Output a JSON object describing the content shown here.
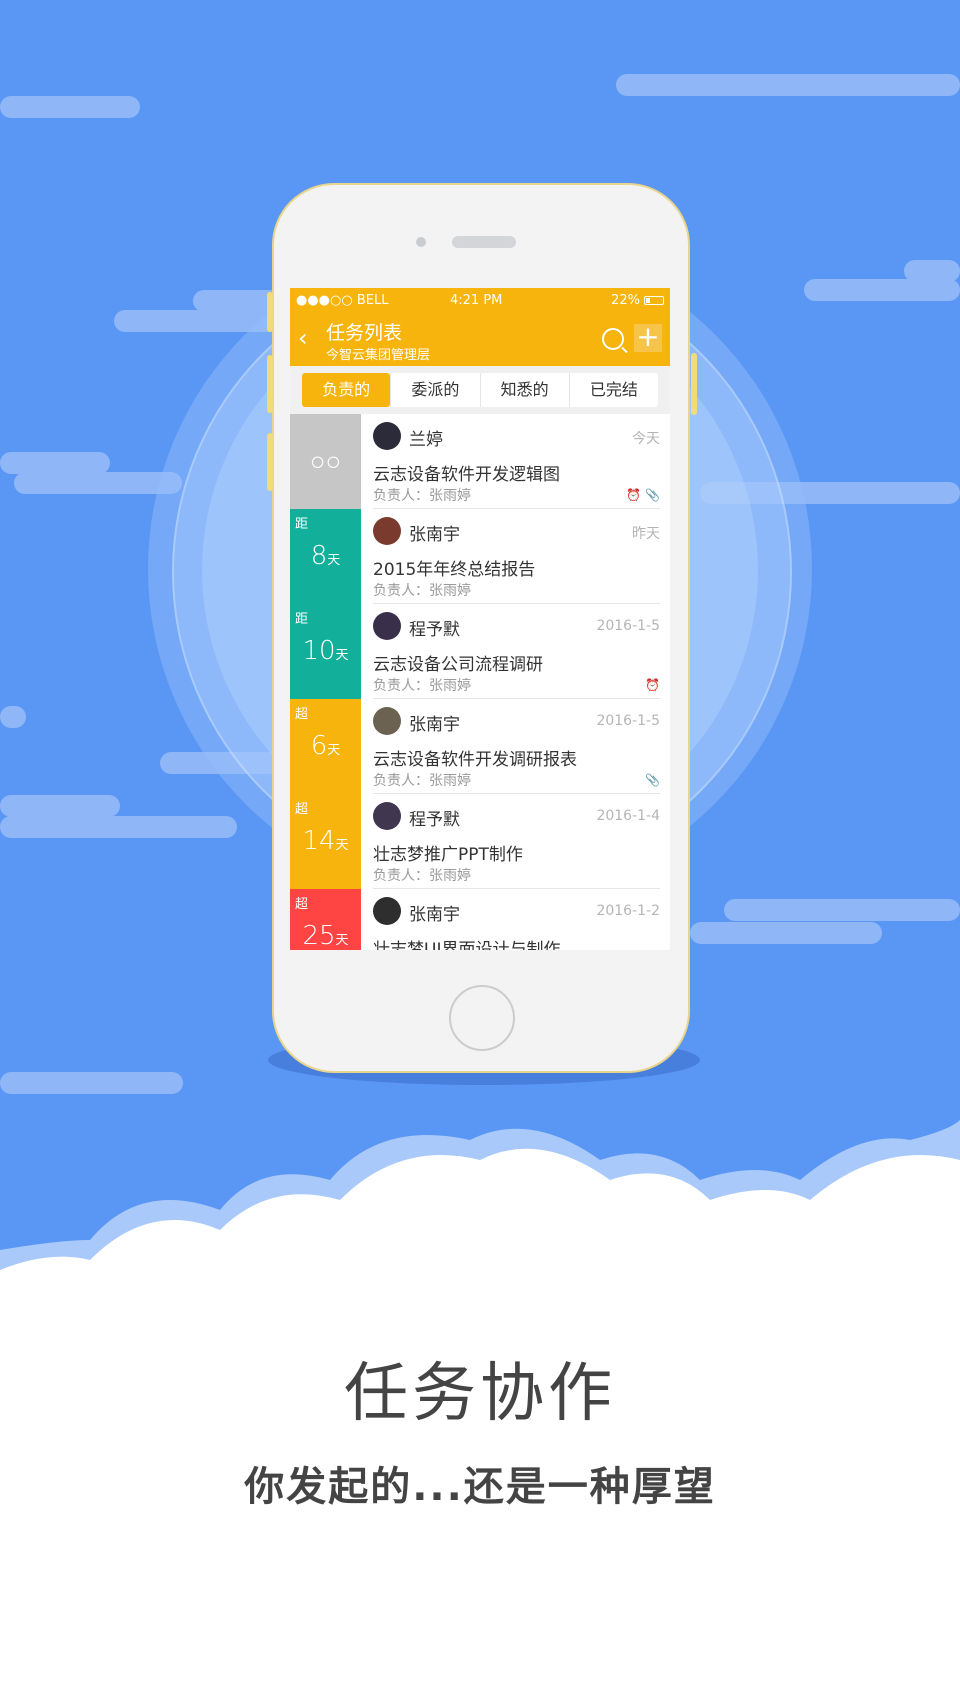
{
  "status_bar": {
    "carrier": "●●●○○ BELL",
    "time": "4:21 PM",
    "battery": "22%"
  },
  "nav": {
    "title": "任务列表",
    "subtitle": "今智云集团管理层"
  },
  "tabs": [
    {
      "label": "负责的",
      "active": true
    },
    {
      "label": "委派的",
      "active": false
    },
    {
      "label": "知悉的",
      "active": false
    },
    {
      "label": "已完结",
      "active": false
    }
  ],
  "owner_label": "负责人：张雨婷",
  "tasks": [
    {
      "badge_prefix": "",
      "badge_value": "○○",
      "badge_unit": "",
      "badge_color": "#c6c6c6",
      "name": "兰婷",
      "date": "今天",
      "title": "云志设备软件开发逻辑图",
      "icons": "⏰ 📎"
    },
    {
      "badge_prefix": "距",
      "badge_value": "8",
      "badge_unit": "天",
      "badge_color": "#12b09a",
      "name": "张南宇",
      "date": "昨天",
      "title": "2015年年终总结报告",
      "icons": ""
    },
    {
      "badge_prefix": "距",
      "badge_value": "10",
      "badge_unit": "天",
      "badge_color": "#12b09a",
      "name": "程予默",
      "date": "2016-1-5",
      "title": "云志设备公司流程调研",
      "icons": "⏰"
    },
    {
      "badge_prefix": "超",
      "badge_value": "6",
      "badge_unit": "天",
      "badge_color": "#f7b40d",
      "name": "张南宇",
      "date": "2016-1-5",
      "title": "云志设备软件开发调研报表",
      "icons": "📎"
    },
    {
      "badge_prefix": "超",
      "badge_value": "14",
      "badge_unit": "天",
      "badge_color": "#f7b40d",
      "name": "程予默",
      "date": "2016-1-4",
      "title": "壮志梦推广PPT制作",
      "icons": ""
    },
    {
      "badge_prefix": "超",
      "badge_value": "25",
      "badge_unit": "天",
      "badge_color": "#ff4444",
      "name": "张南宇",
      "date": "2016-1-2",
      "title": "壮志梦UI界面设计与制作",
      "icons": ""
    }
  ],
  "headline": "任务协作",
  "tagline": "你发起的...还是一种厚望"
}
